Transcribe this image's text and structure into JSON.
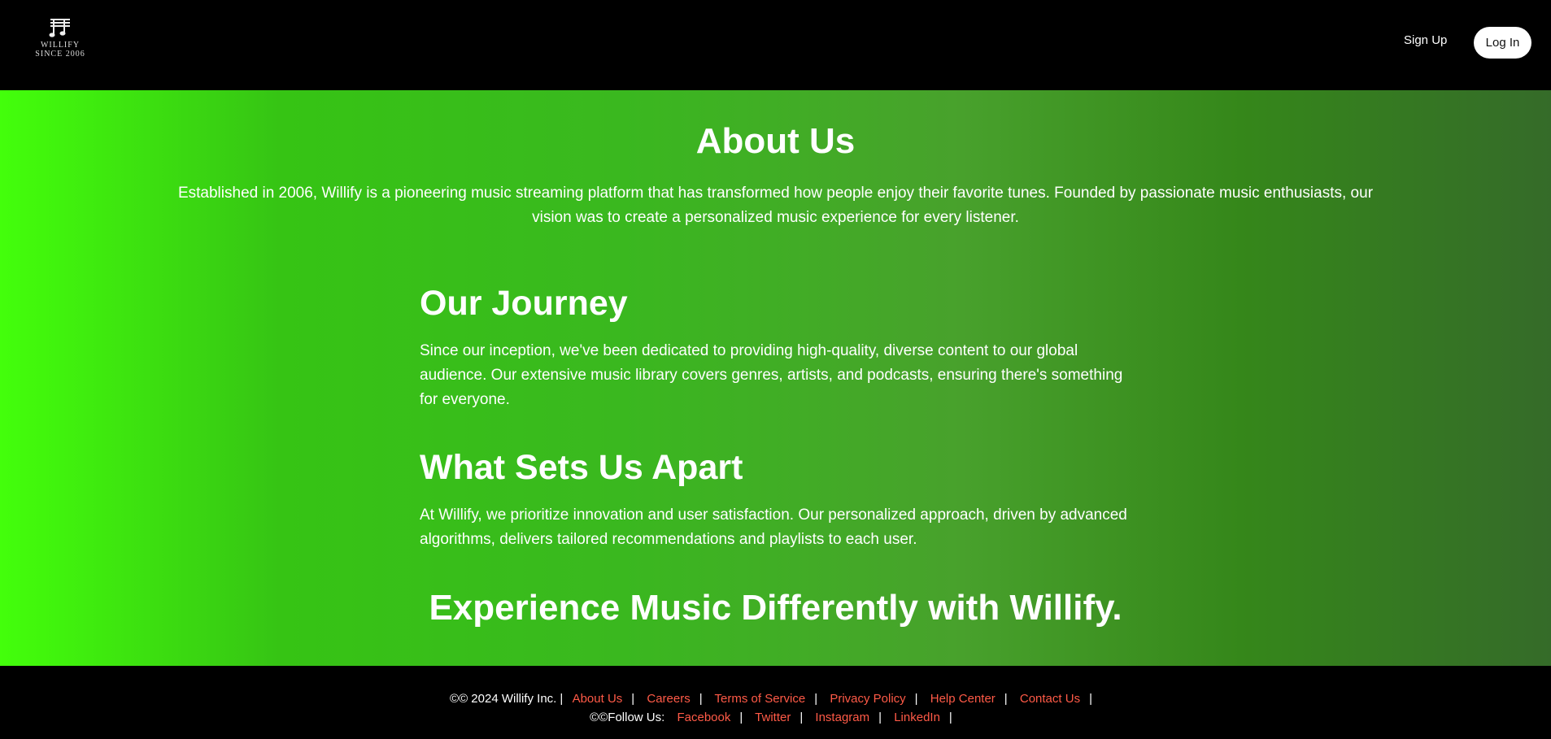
{
  "header": {
    "logo_line1": "WILLIFY",
    "logo_line2": "SINCE 2006",
    "signup_label": "Sign Up",
    "login_label": "Log In"
  },
  "about": {
    "title": "About Us",
    "text": "Established in 2006, Willify is a pioneering music streaming platform that has transformed how people enjoy their favorite tunes. Founded by passionate music enthusiasts, our vision was to create a personalized music experience for every listener."
  },
  "journey": {
    "title": "Our Journey",
    "text": "Since our inception, we've been dedicated to providing high-quality, diverse content to our global audience. Our extensive music library covers genres, artists, and podcasts, ensuring there's something for everyone."
  },
  "apart": {
    "title": "What Sets Us Apart",
    "text": "At Willify, we prioritize innovation and user satisfaction. Our personalized approach, driven by advanced algorithms, delivers tailored recommendations and playlists to each user."
  },
  "tagline": "Experience Music Differently with Willify.",
  "footer": {
    "copyright": "©© 2024 Willify Inc.",
    "links": [
      "About Us",
      "Careers",
      "Terms of Service",
      "Privacy Policy",
      "Help Center",
      "Contact Us"
    ],
    "follow_label": "©©Follow Us:",
    "social": [
      "Facebook",
      "Twitter",
      "Instagram",
      "LinkedIn"
    ],
    "link_color": "#ff5a47"
  }
}
